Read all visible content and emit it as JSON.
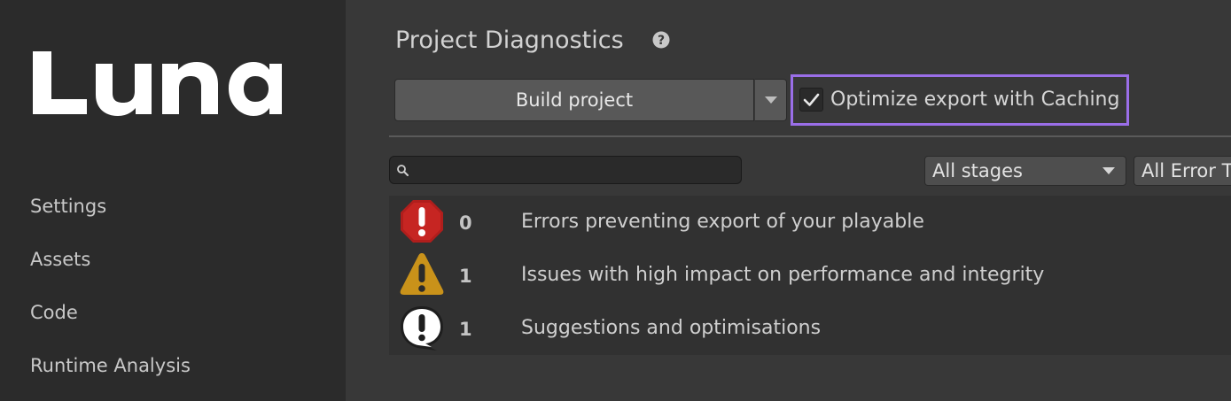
{
  "brand": {
    "logo_text": "Luna"
  },
  "sidebar": {
    "items": [
      {
        "label": "Settings"
      },
      {
        "label": "Assets"
      },
      {
        "label": "Code"
      },
      {
        "label": "Runtime Analysis"
      }
    ]
  },
  "main": {
    "title": "Project Diagnostics",
    "build_button": "Build project",
    "caching": {
      "label": "Optimize export with Caching",
      "checked": true
    },
    "search": {
      "value": "",
      "placeholder": ""
    },
    "stage_filter": {
      "selected": "All stages"
    },
    "error_filter": {
      "selected": "All Error Types"
    },
    "diagnostics": [
      {
        "count": "0",
        "text": "Errors preventing export of your playable",
        "icon": "error-octagon-icon"
      },
      {
        "count": "1",
        "text": "Issues with high impact on performance and integrity",
        "icon": "warning-triangle-icon"
      },
      {
        "count": "1",
        "text": "Suggestions and optimisations",
        "icon": "info-speech-bubble-icon"
      }
    ]
  },
  "colors": {
    "sidebar_bg": "#2b2b2b",
    "main_bg": "#383838",
    "highlight": "#9a6ee8",
    "error": "#c0201e",
    "warning": "#c9921a"
  }
}
